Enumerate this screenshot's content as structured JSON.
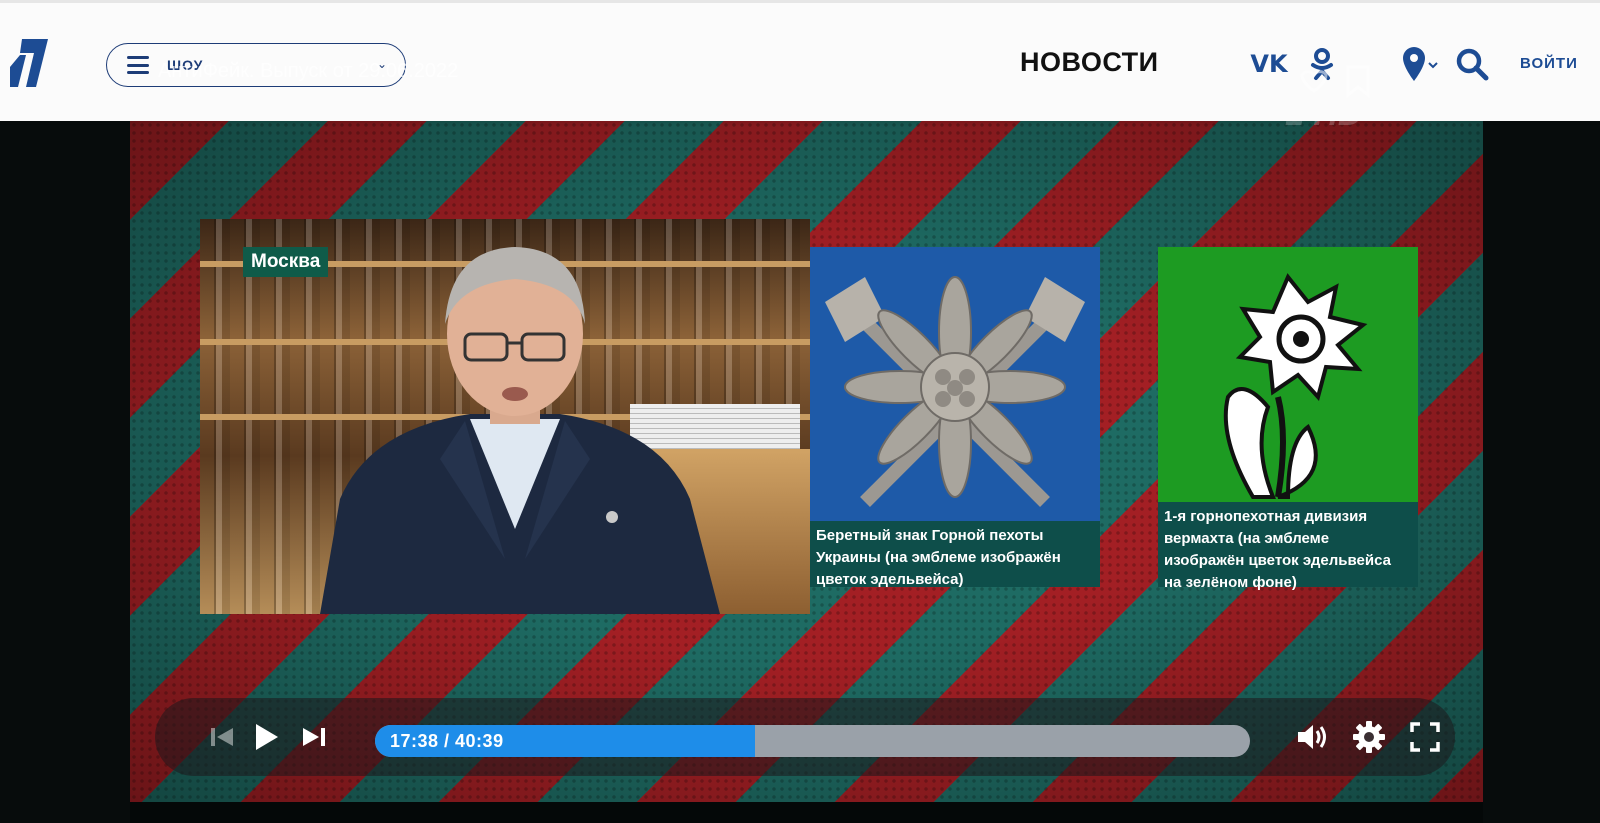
{
  "header": {
    "menu_label": "ШОУ",
    "episode_title": "АнтиФейк. Выпуск от 29.06.2022",
    "news_label": "НОВОСТИ",
    "vk_label": "VK",
    "login_label": "ВОЙТИ"
  },
  "player": {
    "location_tag": "Москва",
    "cards": [
      {
        "caption": "Беретный знак Горной пехоты Украины (на эмблеме изображён цветок эдельвейса)"
      },
      {
        "caption": "1-я горнопехотная дивизия вермахта (на эмблеме изображён цветок эдельвейса на зелёном фоне)"
      }
    ],
    "watermark": "1 HD",
    "current_time": "17:38",
    "duration": "40:39",
    "time_display": "17:38 / 40:39",
    "progress_fraction": 0.434
  },
  "colors": {
    "brand_blue": "#1d3c77",
    "progress_blue": "#1e8de9",
    "stripe_red": "#a31f24",
    "stripe_teal": "#1e6b63",
    "caption_bg": "#0e4e4a"
  },
  "icons": {
    "logo": "channel-one-logo",
    "menu": "hamburger-icon",
    "vk": "vk-icon",
    "ok": "odnoklassniki-icon",
    "location": "location-pin-icon",
    "search": "search-icon",
    "prev": "skip-previous-icon",
    "play": "play-icon",
    "next": "skip-next-icon",
    "volume": "volume-icon",
    "settings": "gear-icon",
    "fullscreen": "fullscreen-icon"
  }
}
